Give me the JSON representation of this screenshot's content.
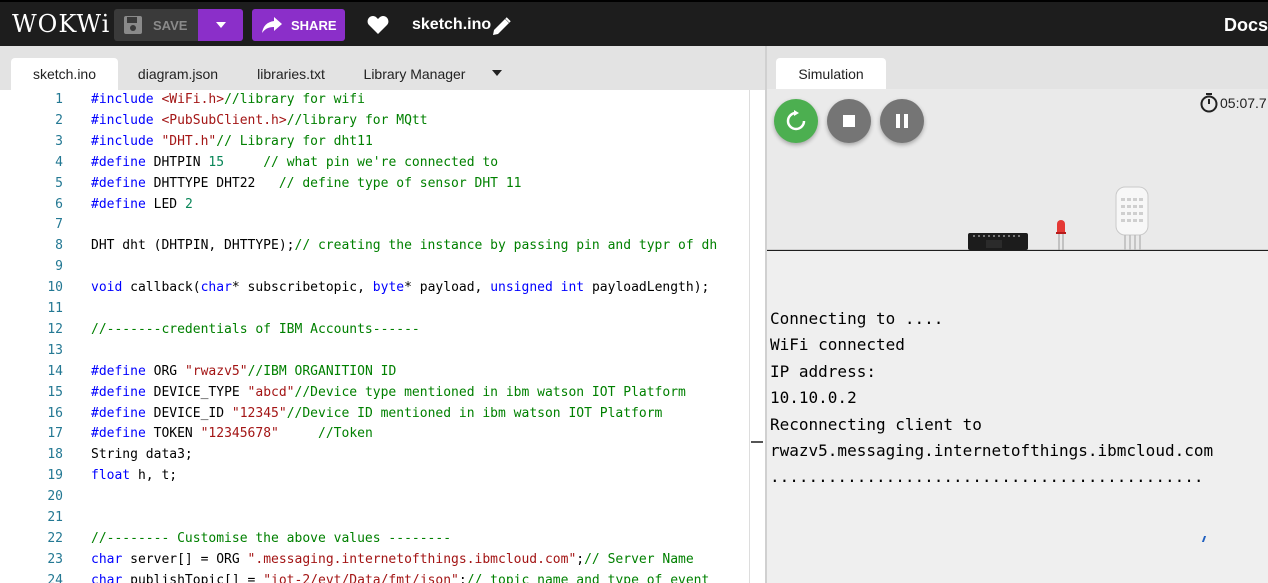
{
  "app": {
    "logo": "WOKWi",
    "docs_label": "Docs",
    "project_title": "sketch.ino"
  },
  "toolbar": {
    "save_label": "SAVE",
    "share_label": "SHARE"
  },
  "editor": {
    "tabs": [
      "sketch.ino",
      "diagram.json",
      "libraries.txt",
      "Library Manager"
    ],
    "active_tab": "sketch.ino",
    "lines": [
      {
        "n": "1",
        "t": "#include <WiFi.h>//library for wifi"
      },
      {
        "n": "2",
        "t": "#include <PubSubClient.h>//library for MQtt"
      },
      {
        "n": "3",
        "t": "#include \"DHT.h\"// Library for dht11"
      },
      {
        "n": "4",
        "t": "#define DHTPIN 15     // what pin we're connected to"
      },
      {
        "n": "5",
        "t": "#define DHTTYPE DHT22   // define type of sensor DHT 11"
      },
      {
        "n": "6",
        "t": "#define LED 2"
      },
      {
        "n": "7",
        "t": ""
      },
      {
        "n": "8",
        "t": "DHT dht (DHTPIN, DHTTYPE);// creating the instance by passing pin and typr of dh"
      },
      {
        "n": "9",
        "t": ""
      },
      {
        "n": "10",
        "t": "void callback(char* subscribetopic, byte* payload, unsigned int payloadLength);"
      },
      {
        "n": "11",
        "t": ""
      },
      {
        "n": "12",
        "t": "//-------credentials of IBM Accounts------"
      },
      {
        "n": "13",
        "t": ""
      },
      {
        "n": "14",
        "t": "#define ORG \"rwazv5\"//IBM ORGANITION ID"
      },
      {
        "n": "15",
        "t": "#define DEVICE_TYPE \"abcd\"//Device type mentioned in ibm watson IOT Platform"
      },
      {
        "n": "16",
        "t": "#define DEVICE_ID \"12345\"//Device ID mentioned in ibm watson IOT Platform"
      },
      {
        "n": "17",
        "t": "#define TOKEN \"12345678\"     //Token"
      },
      {
        "n": "18",
        "t": "String data3;"
      },
      {
        "n": "19",
        "t": "float h, t;"
      },
      {
        "n": "20",
        "t": ""
      },
      {
        "n": "21",
        "t": ""
      },
      {
        "n": "22",
        "t": "//-------- Customise the above values --------"
      },
      {
        "n": "23",
        "t": "char server[] = ORG \".messaging.internetofthings.ibmcloud.com\";// Server Name"
      },
      {
        "n": "24",
        "t": "char publishTopic[] = \"iot-2/evt/Data/fmt/json\";// topic name and type of event"
      }
    ]
  },
  "simulation": {
    "tab_label": "Simulation",
    "timer": "05:07.7",
    "serial_lines": [
      "Connecting to ....",
      "WiFi connected",
      "IP address:",
      "10.10.0.2",
      "Reconnecting client to",
      "rwazv5.messaging.internetofthings.ibmcloud.com",
      "............................................."
    ]
  },
  "colors": {
    "accent": "#8b2fc9",
    "restart": "#4caf50",
    "control": "#757575",
    "led": "#e53935"
  }
}
